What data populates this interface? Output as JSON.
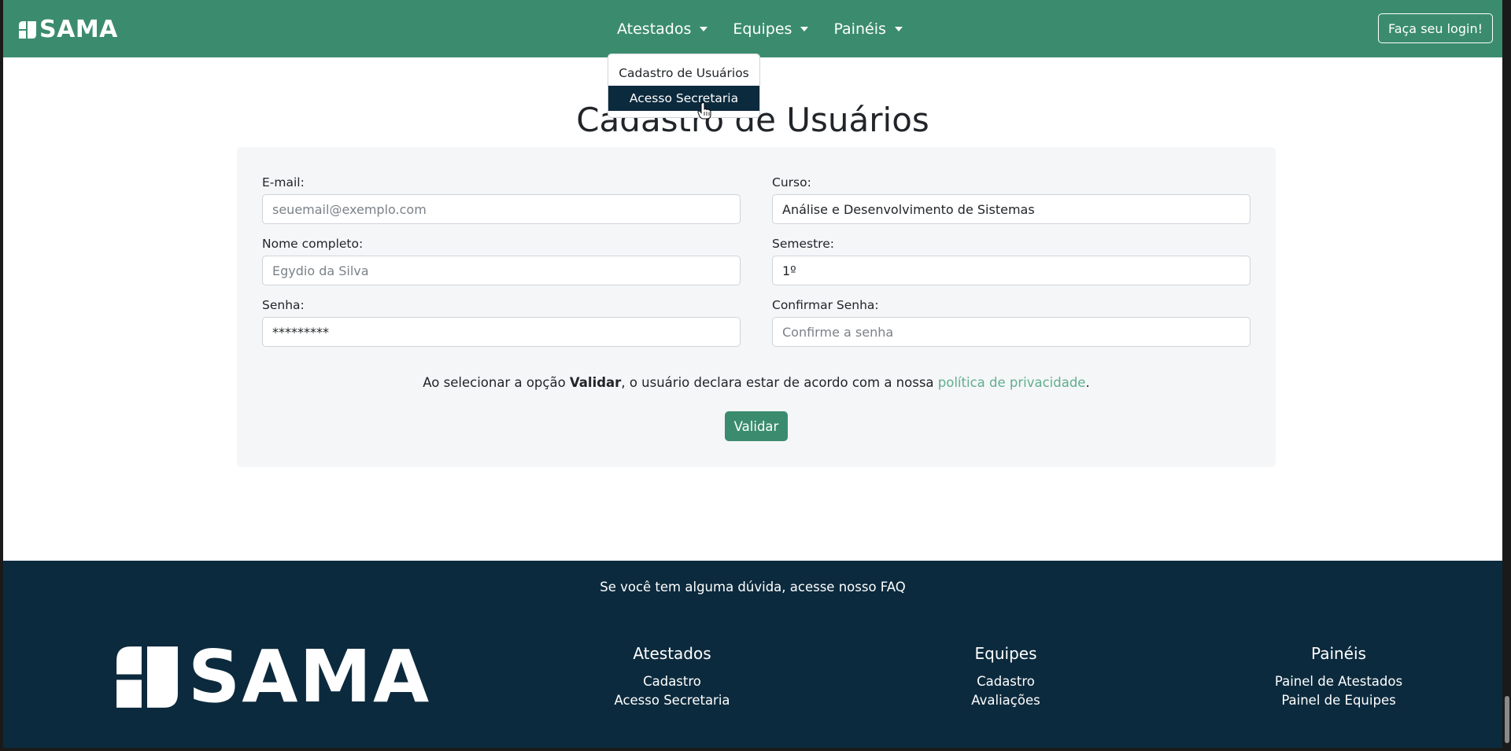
{
  "navbar": {
    "brand": "SAMA",
    "menu": [
      {
        "label": "Atestados"
      },
      {
        "label": "Equipes"
      },
      {
        "label": "Painéis"
      }
    ],
    "login_label": "Faça seu login!"
  },
  "dropdown": {
    "items": [
      {
        "label": "Cadastro de Usuários",
        "active": false
      },
      {
        "label": "Acesso Secretaria",
        "active": true
      }
    ]
  },
  "main": {
    "title": "Cadastro de Usuários",
    "form": {
      "email": {
        "label": "E-mail:",
        "placeholder": "seuemail@exemplo.com",
        "value": ""
      },
      "nome": {
        "label": "Nome completo:",
        "placeholder": "Egydio da Silva",
        "value": ""
      },
      "senha": {
        "label": "Senha:",
        "placeholder": "",
        "value": "*********"
      },
      "curso": {
        "label": "Curso:",
        "placeholder": "",
        "value": "Análise e Desenvolvimento de Sistemas"
      },
      "semestre": {
        "label": "Semestre:",
        "placeholder": "",
        "value": "1º"
      },
      "confirmar": {
        "label": "Confirmar Senha:",
        "placeholder": "Confirme a senha",
        "value": ""
      }
    },
    "policy": {
      "prefix": "Ao selecionar a opção ",
      "bold": "Validar",
      "middle": ", o usuário declara estar de acordo com a nossa ",
      "link": "política de privacidade",
      "suffix": "."
    },
    "validate_label": "Validar"
  },
  "footer": {
    "faq_prefix": "Se você tem alguma dúvida, acesse nosso ",
    "faq_link": "FAQ",
    "brand": "SAMA",
    "columns": [
      {
        "title": "Atestados",
        "links": [
          "Cadastro",
          "Acesso Secretaria"
        ]
      },
      {
        "title": "Equipes",
        "links": [
          "Cadastro",
          "Avaliações"
        ]
      },
      {
        "title": "Painéis",
        "links": [
          "Painel de Atestados",
          "Painel de Equipes"
        ]
      }
    ]
  },
  "colors": {
    "primary_green": "#3b8c6e",
    "footer_navy": "#0c2a3d",
    "link_green": "#5fae8f",
    "card_bg": "#f5f6f7"
  }
}
